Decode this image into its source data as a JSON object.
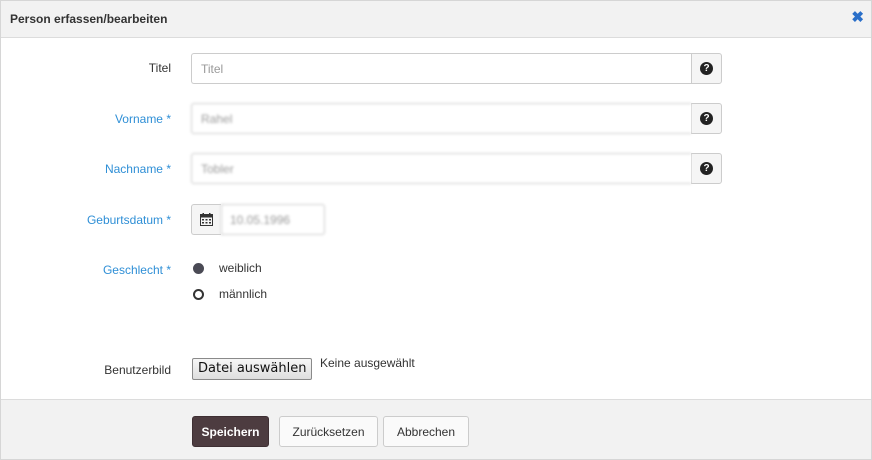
{
  "dialog": {
    "title": "Person erfassen/bearbeiten",
    "close_icon": "close-icon"
  },
  "fields": {
    "titel": {
      "label": "Titel",
      "placeholder": "Titel",
      "value": ""
    },
    "vorname": {
      "label": "Vorname *",
      "value": "Rahel"
    },
    "nachname": {
      "label": "Nachname *",
      "value": "Tobler"
    },
    "geburtsdatum": {
      "label": "Geburtsdatum *",
      "value": "10.05.1996",
      "icon": "calendar-icon"
    },
    "geschlecht": {
      "label": "Geschlecht *",
      "options": [
        {
          "label": "weiblich",
          "selected": true
        },
        {
          "label": "männlich",
          "selected": false
        }
      ]
    },
    "benutzerbild": {
      "label": "Benutzerbild",
      "button_label": "Datei auswählen",
      "status": "Keine ausgewählt"
    },
    "help_icon_glyph": "?"
  },
  "footer": {
    "save_label": "Speichern",
    "reset_label": "Zurücksetzen",
    "cancel_label": "Abbrechen"
  },
  "colors": {
    "required_label": "#2f8fd6",
    "primary_button": "#4d3c40",
    "close_icon": "#2a6fc9"
  }
}
